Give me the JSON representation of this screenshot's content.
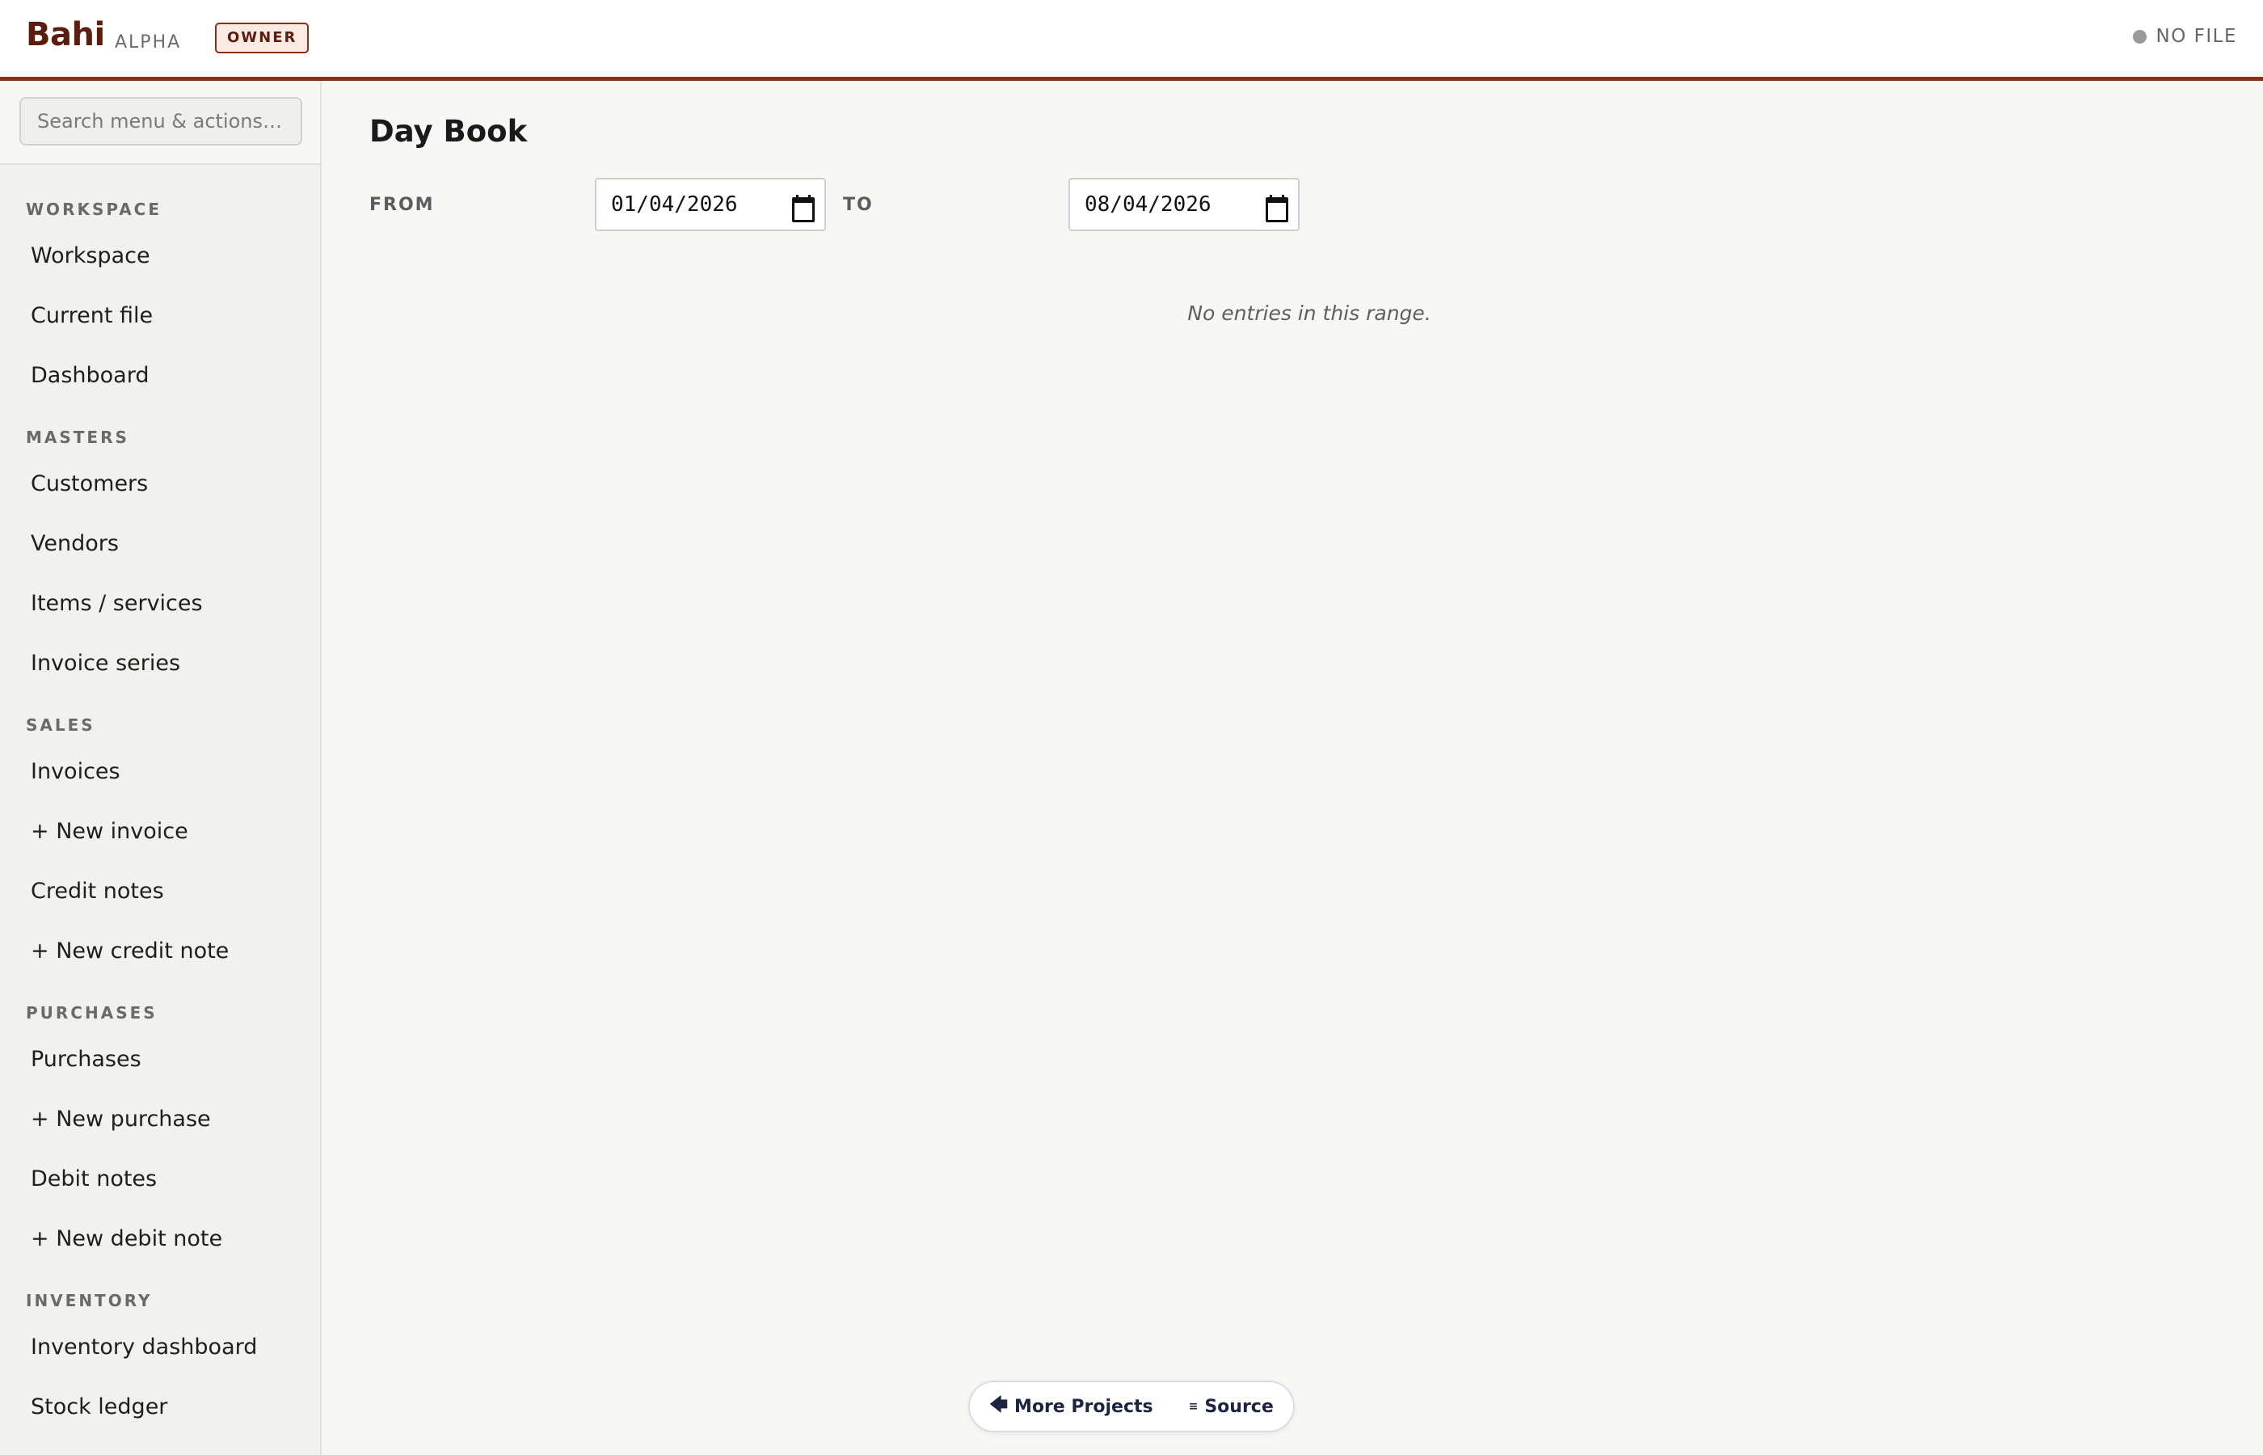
{
  "header": {
    "brand": "Bahi",
    "tag": "ALPHA",
    "role": "OWNER",
    "file_status": "NO FILE",
    "accent_color": "#8a2f18"
  },
  "sidebar": {
    "search_placeholder": "Search menu & actions…",
    "sections": [
      {
        "title": "WORKSPACE",
        "items": [
          "Workspace",
          "Current file",
          "Dashboard"
        ]
      },
      {
        "title": "MASTERS",
        "items": [
          "Customers",
          "Vendors",
          "Items / services",
          "Invoice series"
        ]
      },
      {
        "title": "SALES",
        "items": [
          "Invoices",
          "+ New invoice",
          "Credit notes",
          "+ New credit note"
        ]
      },
      {
        "title": "PURCHASES",
        "items": [
          "Purchases",
          "+ New purchase",
          "Debit notes",
          "+ New debit note"
        ]
      },
      {
        "title": "INVENTORY",
        "items": [
          "Inventory dashboard",
          "Stock ledger"
        ]
      }
    ]
  },
  "main": {
    "title": "Day Book",
    "from_label": "FROM",
    "from_value": "01/04/2026",
    "to_label": "TO",
    "to_value": "08/04/2026",
    "empty_message": "No entries in this range."
  },
  "footer": {
    "more_projects": "More Projects",
    "source": "Source",
    "more_projects_icon": "arrow-left-icon",
    "source_icon": "code-icon"
  }
}
